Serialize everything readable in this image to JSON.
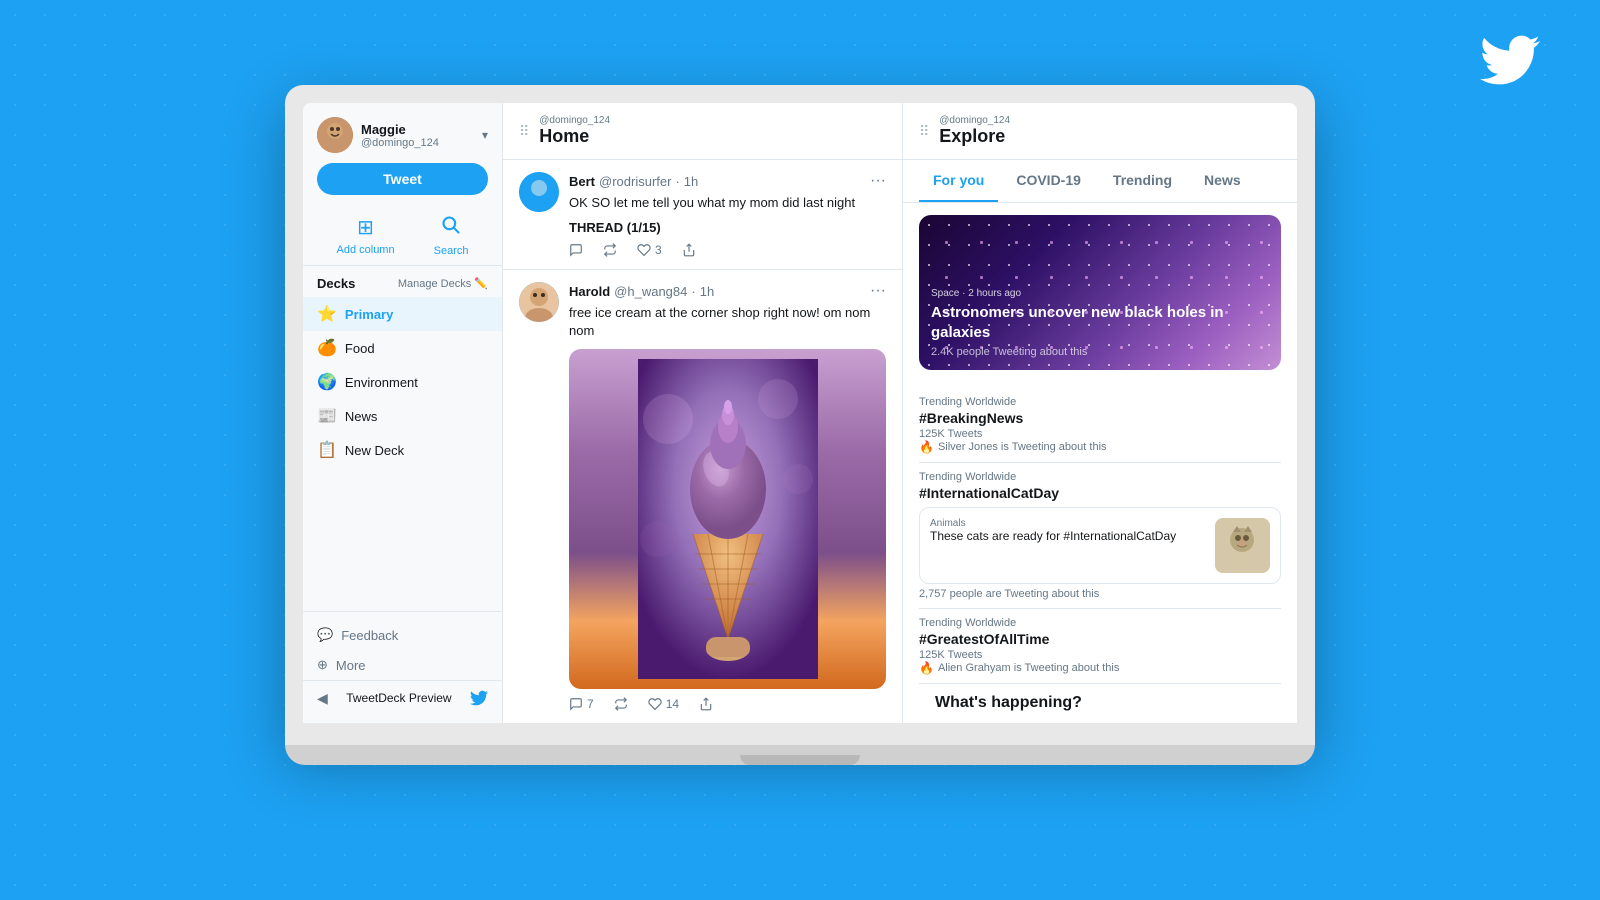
{
  "background": {
    "color": "#1da1f2"
  },
  "twitter_bird": "🐦",
  "sidebar": {
    "profile": {
      "display_name": "Maggie",
      "username": "@domingo_124",
      "avatar_emoji": "👩"
    },
    "tweet_button": "Tweet",
    "actions": [
      {
        "name": "add-column",
        "label": "Add column",
        "icon": "⊞"
      },
      {
        "name": "search",
        "label": "Search",
        "icon": "🔍"
      }
    ],
    "decks_title": "Decks",
    "manage_decks": "Manage Decks",
    "decks": [
      {
        "name": "Primary",
        "icon": "⭐",
        "active": true
      },
      {
        "name": "Food",
        "icon": "🍊"
      },
      {
        "name": "Environment",
        "icon": "🌍"
      },
      {
        "name": "News",
        "icon": "📰"
      },
      {
        "name": "New Deck",
        "icon": "📋"
      }
    ],
    "footer_items": [
      {
        "name": "Feedback",
        "icon": "💬"
      },
      {
        "name": "More",
        "icon": "⊕"
      }
    ],
    "preview_label": "TweetDeck Preview",
    "preview_icon": "🐦"
  },
  "home_column": {
    "user_label": "@domingo_124",
    "title": "Home",
    "tweets": [
      {
        "author": "Bert",
        "handle": "@rodrisurfer",
        "time": "1h",
        "text": "OK SO let me tell you what my mom did last night",
        "thread_label": "THREAD (1/15)",
        "replies": "",
        "retweets": "",
        "likes": "3"
      },
      {
        "author": "Harold",
        "handle": "@h_wang84",
        "time": "1h",
        "text": "free ice cream at the corner shop right now! om nom nom",
        "has_image": true,
        "replies": "7",
        "retweets": "",
        "likes": "14"
      }
    ]
  },
  "explore_column": {
    "user_label": "@domingo_124",
    "title": "Explore",
    "tabs": [
      {
        "label": "For you",
        "active": true
      },
      {
        "label": "COVID-19",
        "active": false
      },
      {
        "label": "Trending",
        "active": false
      },
      {
        "label": "News",
        "active": false
      }
    ],
    "hero": {
      "category": "Space · 2 hours ago",
      "title": "Astronomers uncover new black holes in galaxies",
      "count": "2.4K people Tweeting about this"
    },
    "trending_items": [
      {
        "label": "Trending Worldwide",
        "tag": "#BreakingNews",
        "count": "125K Tweets",
        "user_note": "Silver Jones is Tweeting about this"
      },
      {
        "label": "Trending Worldwide",
        "tag": "#InternationalCatDay",
        "count": "",
        "has_card": true,
        "card": {
          "category": "Animals",
          "title": "These cats are ready for #InternationalCatDay",
          "image_emoji": "🐱"
        },
        "people_count": "2,757 people are Tweeting about this"
      },
      {
        "label": "Trending Worldwide",
        "tag": "#GreatestOfAllTime",
        "count": "125K Tweets",
        "user_note": "Alien Grahyam is Tweeting about this"
      }
    ],
    "whats_happening": "What's happening?"
  }
}
